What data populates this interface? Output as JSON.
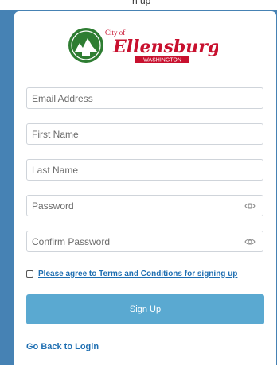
{
  "header": {
    "top_text": "n up"
  },
  "logo": {
    "city_of": "City of",
    "name": "Ellensburg",
    "state": "WASHINGTON",
    "colors": {
      "seal_green": "#2e7d32",
      "script_red": "#c8102e"
    }
  },
  "form": {
    "email": {
      "placeholder": "Email Address",
      "value": ""
    },
    "first_name": {
      "placeholder": "First Name",
      "value": ""
    },
    "last_name": {
      "placeholder": "Last Name",
      "value": ""
    },
    "password": {
      "placeholder": "Password",
      "value": "",
      "icon": "eye-icon"
    },
    "confirm_password": {
      "placeholder": "Confirm Password",
      "value": "",
      "icon": "eye-icon"
    },
    "agree_label": "Please agree to Terms and Conditions for signing up",
    "agree_checked": false,
    "signup_label": "Sign Up",
    "back_label": "Go Back to Login"
  },
  "colors": {
    "frame": "#4682b4",
    "button": "#5aa9d1",
    "link": "#1f6fb2"
  }
}
